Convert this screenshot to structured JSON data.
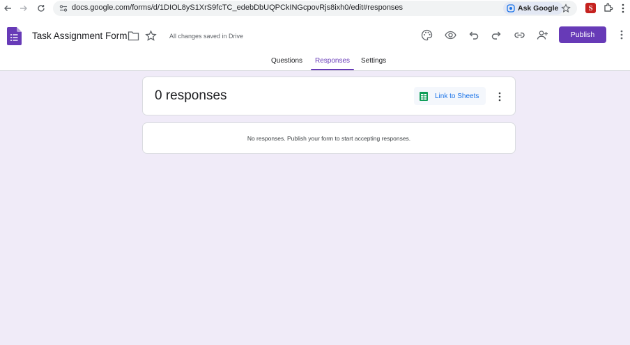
{
  "browser": {
    "url": "docs.google.com/forms/d/1DIOL8yS1XrS9fcTC_edebDbUQPCkINGcpovRjs8ixh0/edit#responses",
    "ask_google_label": "Ask Google",
    "icons": [
      "back-icon",
      "forward-icon",
      "reload-icon",
      "site-info-icon",
      "bookmark-star-icon",
      "extension-s-icon",
      "puzzle-icon",
      "more-vert-icon"
    ],
    "extension_letter": "S"
  },
  "header": {
    "title": "Task Assignment Form",
    "saved_status": "All changes saved in Drive",
    "publish_label": "Publish",
    "accent_color": "#673ab7"
  },
  "tabs": [
    {
      "label": "Questions",
      "active": false
    },
    {
      "label": "Responses",
      "active": true
    },
    {
      "label": "Settings",
      "active": false
    }
  ],
  "summary": {
    "count_text": "0 responses",
    "link_sheets_label": "Link to Sheets"
  },
  "empty_state": {
    "message": "No responses. Publish your form to start accepting responses."
  },
  "colors": {
    "background": "#f0ebf8",
    "sheets_green": "#0f9d58",
    "link_blue": "#1a73e8"
  }
}
